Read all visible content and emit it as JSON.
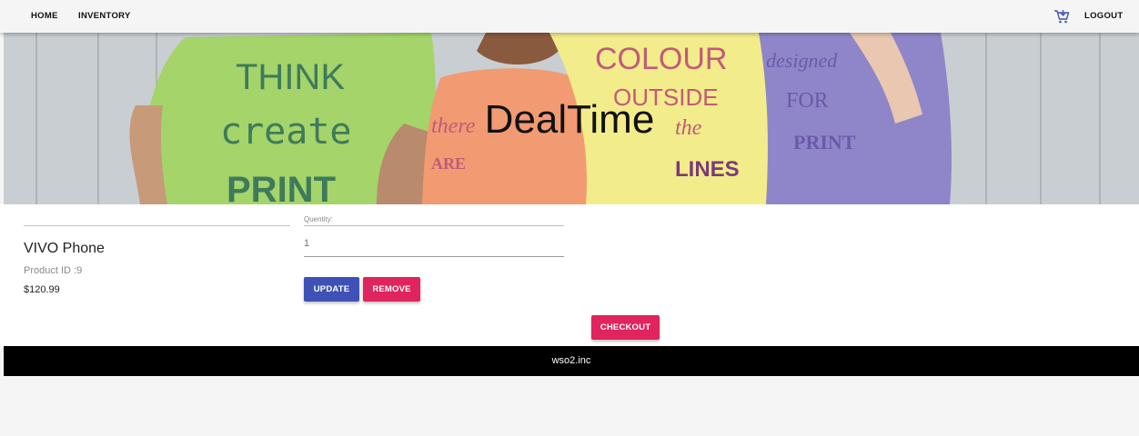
{
  "nav": {
    "home": "HOME",
    "inventory": "INVENTORY",
    "logout": "LOGOUT",
    "cart_icon": "cart-icon"
  },
  "hero": {
    "title": "DealTime",
    "shirts": {
      "green": {
        "line1": "THINK",
        "line2": "create",
        "line3": "PRINT"
      },
      "orange": {
        "line1": "there",
        "line2": "ARE"
      },
      "yellow": {
        "line1": "COLOUR",
        "line2": "OUTSIDE",
        "line3": "the",
        "line4": "LINES"
      },
      "purple": {
        "line1": "designed",
        "line2": "FOR",
        "line3": "PRINT"
      }
    }
  },
  "cart": {
    "item": {
      "name": "VIVO Phone",
      "product_id": "Product ID :9",
      "price": "$120.99"
    },
    "quantity_label": "Quentity:",
    "quantity_value": "1",
    "update_label": "UPDATE",
    "remove_label": "REMOVE",
    "checkout_label": "CHECKOUT"
  },
  "footer": {
    "text": "wso2.inc"
  },
  "colors": {
    "primary": "#3f51b5",
    "accent": "#e0245e",
    "footer_bg": "#000000"
  }
}
